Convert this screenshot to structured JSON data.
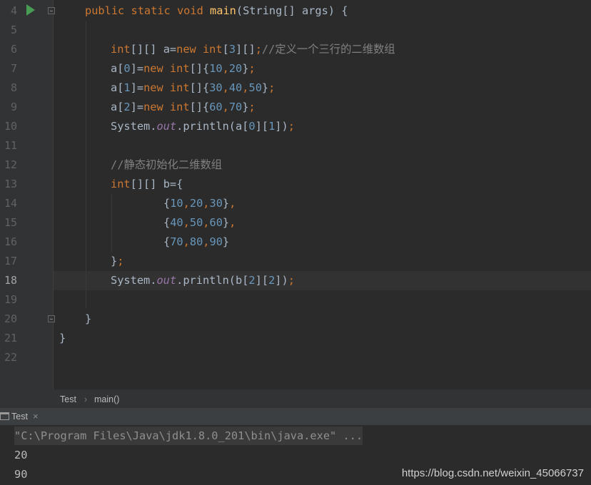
{
  "editor": {
    "line_numbers": [
      "4",
      "5",
      "6",
      "7",
      "8",
      "9",
      "10",
      "11",
      "12",
      "13",
      "14",
      "15",
      "16",
      "17",
      "18",
      "19",
      "20",
      "21",
      "22"
    ],
    "line4": {
      "kw1": "public",
      "kw2": "static",
      "kw3": "void",
      "fn": "main",
      "rest": "(String[] args) {"
    },
    "line6": {
      "t1": "int",
      "t2": "[][] a=",
      "t3": "new",
      "t4": " ",
      "t5": "int",
      "t6": "[",
      "n1": "3",
      "t7": "][]",
      "t8": ";",
      "cm": "//定义一个三行的二维数组"
    },
    "line7": {
      "t1": "a[",
      "n1": "0",
      "t2": "]=",
      "kw": "new",
      "t3": " ",
      "kw2": "int",
      "t4": "[]{",
      "n2": "10",
      "c1": ",",
      "n3": "20",
      "t5": "}",
      "semi": ";"
    },
    "line8": {
      "t1": "a[",
      "n1": "1",
      "t2": "]=",
      "kw": "new",
      "t3": " ",
      "kw2": "int",
      "t4": "[]{",
      "n2": "30",
      "c1": ",",
      "n3": "40",
      "c2": ",",
      "n4": "50",
      "t5": "}",
      "semi": ";"
    },
    "line9": {
      "t1": "a[",
      "n1": "2",
      "t2": "]=",
      "kw": "new",
      "t3": " ",
      "kw2": "int",
      "t4": "[]{",
      "n2": "60",
      "c1": ",",
      "n3": "70",
      "t5": "}",
      "semi": ";"
    },
    "line10": {
      "t1": "System.",
      "fld": "out",
      "t2": ".println(a[",
      "n1": "0",
      "t3": "][",
      "n2": "1",
      "t4": "])",
      "semi": ";"
    },
    "line12": {
      "cm": "//静态初始化二维数组"
    },
    "line13": {
      "kw": "int",
      "t1": "[][] b={"
    },
    "line14": {
      "t1": "{",
      "n1": "10",
      "c1": ",",
      "n2": "20",
      "c2": ",",
      "n3": "30",
      "t2": "}",
      "c3": ","
    },
    "line15": {
      "t1": "{",
      "n1": "40",
      "c1": ",",
      "n2": "50",
      "c2": ",",
      "n3": "60",
      "t2": "}",
      "c3": ","
    },
    "line16": {
      "t1": "{",
      "n1": "70",
      "c1": ",",
      "n2": "80",
      "c2": ",",
      "n3": "90",
      "t2": "}"
    },
    "line17": {
      "t1": "}",
      "semi": ";"
    },
    "line18": {
      "t1": "System.",
      "fld": "out",
      "t2": ".println(b[",
      "n1": "2",
      "t3": "][",
      "n2": "2",
      "t4": "])",
      "semi": ";"
    },
    "line20": {
      "t1": "}"
    },
    "line21": {
      "t1": "}"
    }
  },
  "breadcrumb": {
    "class_name": "Test",
    "separator": "›",
    "method": "main()"
  },
  "run_tab": {
    "label": "Test",
    "close": "×"
  },
  "console": {
    "command": "\"C:\\Program Files\\Java\\jdk1.8.0_201\\bin\\java.exe\" ...",
    "output1": "20",
    "output2": "90"
  },
  "watermark": "https://blog.csdn.net/weixin_45066737",
  "colors": {
    "keyword": "#cc7832",
    "number": "#6897bb",
    "comment": "#808080",
    "field": "#9876aa",
    "function": "#ffc66d",
    "text": "#a9b7c6",
    "background": "#2b2b2b"
  }
}
